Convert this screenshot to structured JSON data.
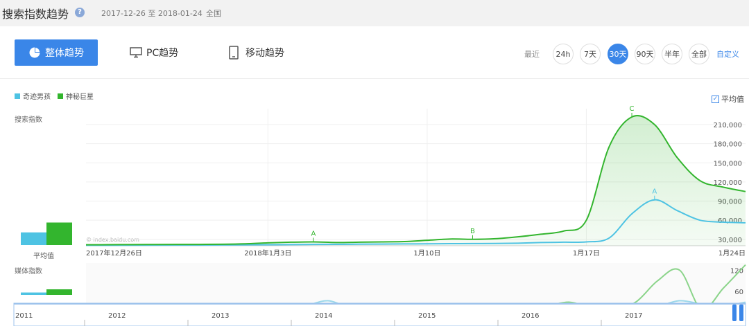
{
  "header": {
    "title": "搜索指数趋势",
    "date_range": "2017-12-26 至 2018-01-24",
    "region": "全国"
  },
  "toolbar": {
    "overall_label": "整体趋势",
    "pc_label": "PC趋势",
    "mobile_label": "移动趋势",
    "recent_label": "最近",
    "ranges": [
      "24h",
      "7天",
      "30天",
      "90天",
      "半年",
      "全部"
    ],
    "active_range": "30天",
    "custom_label": "自定义"
  },
  "legend": {
    "series": [
      {
        "name": "奇迹男孩",
        "color": "#4ec3e3"
      },
      {
        "name": "神秘巨星",
        "color": "#33b52e"
      }
    ],
    "average_toggle": "平均值",
    "average_checked": true
  },
  "labels": {
    "search_index": "搜索指数",
    "media_index": "媒体指数",
    "average": "平均值",
    "watermark": "© index.baidu.com"
  },
  "chart_data": [
    {
      "type": "line",
      "title": "",
      "ylabel": "搜索指数",
      "x_tick_labels": [
        "2017年12月26日",
        "2018年1月3日",
        "1月10日",
        "1月17日",
        "1月24日"
      ],
      "x_tick_index": [
        0,
        8,
        15,
        22,
        29
      ],
      "y_ticks": [
        30000,
        60000,
        90000,
        120000,
        150000,
        180000,
        210000
      ],
      "ylim": [
        20000,
        235000
      ],
      "grid": true,
      "series": [
        {
          "name": "奇迹男孩",
          "color": "#4ec3e3",
          "values": [
            20500,
            20600,
            20700,
            20800,
            20900,
            21000,
            21200,
            21400,
            21500,
            21800,
            22000,
            22200,
            22400,
            22600,
            22800,
            23000,
            23200,
            23400,
            23500,
            24000,
            25000,
            25500,
            26000,
            32000,
            70000,
            92000,
            75000,
            60000,
            57000,
            56000
          ]
        },
        {
          "name": "神秘巨星",
          "color": "#33b52e",
          "values": [
            21500,
            21600,
            21800,
            21900,
            22000,
            22100,
            22300,
            23000,
            24500,
            25500,
            26000,
            25000,
            25500,
            26000,
            26500,
            28500,
            30500,
            30000,
            31000,
            34000,
            38000,
            43000,
            60000,
            175000,
            222000,
            210000,
            158000,
            122000,
            112000,
            105000
          ]
        }
      ],
      "annotations": [
        {
          "label": "A",
          "series": "神秘巨星",
          "index": 10
        },
        {
          "label": "B",
          "series": "神秘巨星",
          "index": 17
        },
        {
          "label": "C",
          "series": "神秘巨星",
          "index": 24
        },
        {
          "label": "A",
          "series": "奇迹男孩",
          "index": 25
        }
      ],
      "average": [
        {
          "series": "奇迹男孩",
          "value": 32000
        },
        {
          "series": "神秘巨星",
          "value": 57000
        }
      ]
    },
    {
      "type": "line",
      "title": "",
      "ylabel": "媒体指数",
      "y_ticks": [
        60,
        120
      ],
      "ylim": [
        0,
        140
      ],
      "series": [
        {
          "name": "奇迹男孩",
          "color": "#9ad7ea",
          "values": [
            10,
            10,
            9,
            9,
            8,
            9,
            10,
            10,
            10,
            10,
            20,
            34,
            15,
            9,
            9,
            9,
            10,
            10,
            10,
            12,
            15,
            20,
            25,
            15,
            8,
            10,
            18,
            34,
            25,
            20,
            30
          ]
        },
        {
          "name": "神秘巨星",
          "color": "#8bd48a",
          "values": [
            5,
            5,
            6,
            6,
            7,
            6,
            6,
            6,
            7,
            7,
            8,
            9,
            10,
            10,
            9,
            8,
            8,
            9,
            10,
            10,
            12,
            20,
            30,
            15,
            12,
            30,
            90,
            120,
            10,
            70,
            135
          ]
        }
      ],
      "average": [
        {
          "series": "奇迹男孩",
          "value": 12
        },
        {
          "series": "神秘巨星",
          "value": 28
        }
      ]
    }
  ],
  "timeline": {
    "years": [
      "2011",
      "2012",
      "2013",
      "2014",
      "2015",
      "2016",
      "2017"
    ]
  }
}
